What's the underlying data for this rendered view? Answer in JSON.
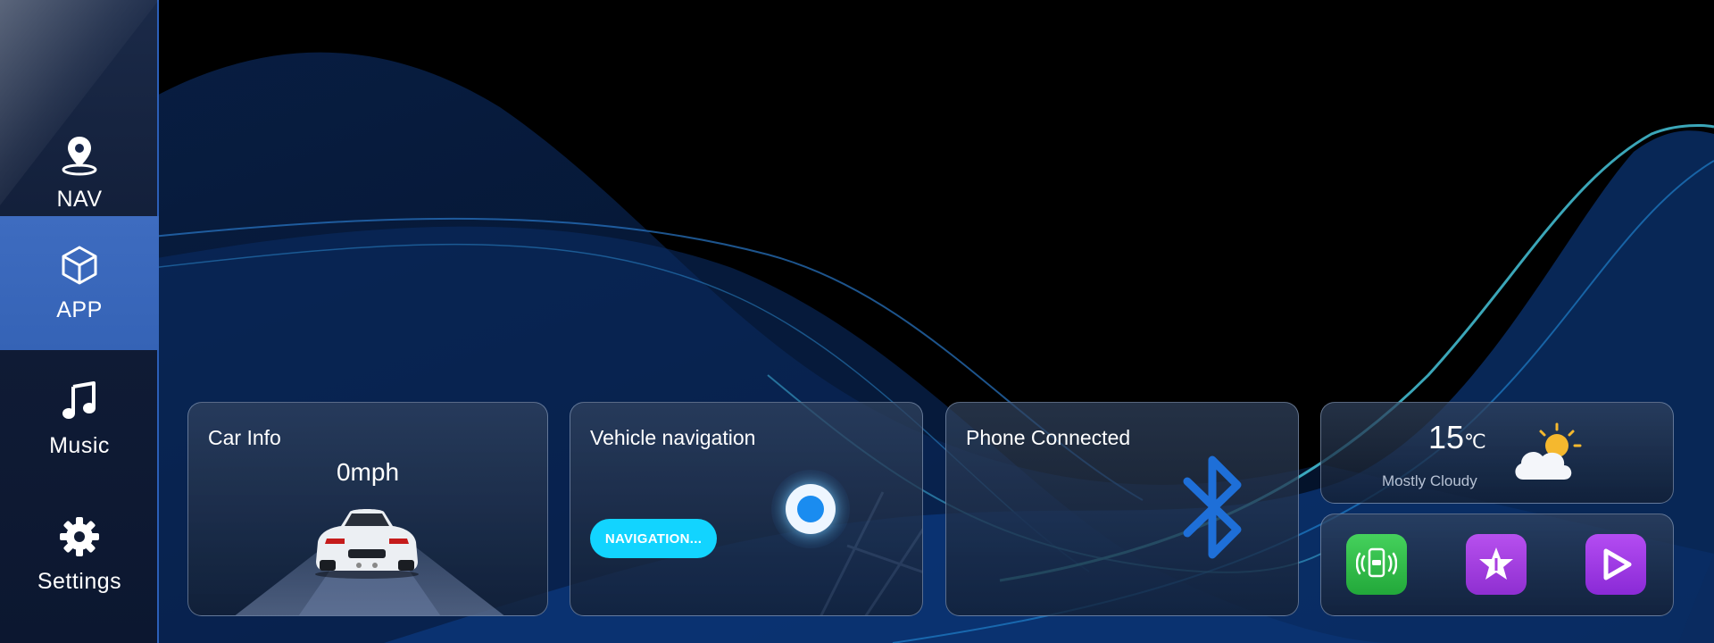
{
  "sidebar": {
    "items": [
      {
        "label": "NAV",
        "icon": "location-pin-icon",
        "active": false
      },
      {
        "label": "APP",
        "icon": "cube-icon",
        "active": true
      },
      {
        "label": "Music",
        "icon": "music-note-icon",
        "active": false
      },
      {
        "label": "Settings",
        "icon": "gear-icon",
        "active": false
      }
    ],
    "accent_color": "#3e6cc0"
  },
  "cards": {
    "car_info": {
      "title": "Car Info",
      "speed": "0mph"
    },
    "navigation": {
      "title": "Vehicle navigation",
      "button_label": "NAVIGATION..."
    },
    "phone": {
      "title": "Phone Connected",
      "icon": "bluetooth-icon"
    },
    "weather": {
      "temperature": "15",
      "unit": "℃",
      "description": "Mostly Cloudy",
      "icon": "partly-cloudy-sun-icon"
    },
    "apps": [
      {
        "name": "phone-car-link-icon",
        "color": "#2fc14a"
      },
      {
        "name": "star-app-icon",
        "color": "#a93ee0"
      },
      {
        "name": "play-app-icon",
        "color": "#a23ce6"
      }
    ]
  },
  "colors": {
    "button": "#12d4ff",
    "bluetooth": "#1e6fd8"
  }
}
